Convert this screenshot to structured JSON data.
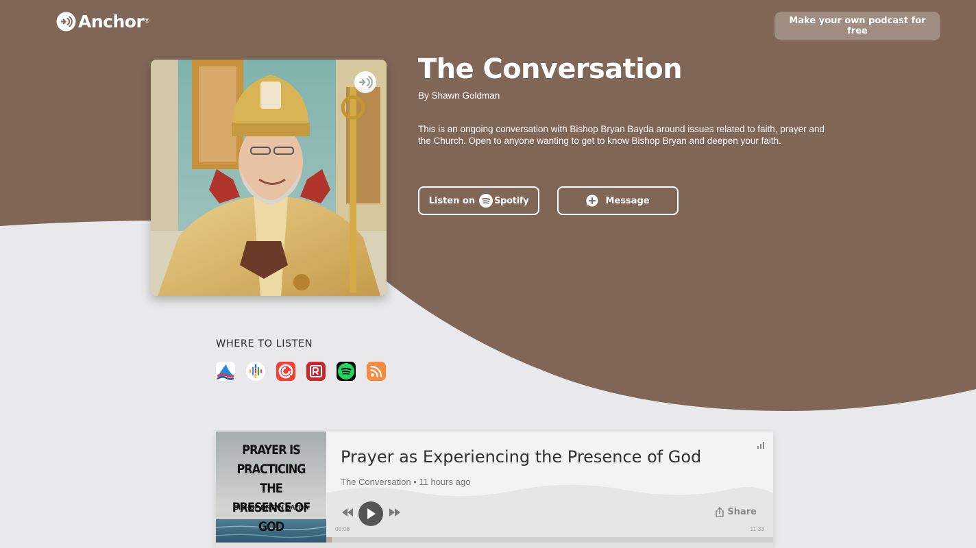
{
  "header": {
    "logo_text": "Anchor",
    "logo_reg": "®",
    "cta_label": "Make your own podcast for free"
  },
  "podcast": {
    "title": "The Conversation",
    "author": "By Shawn Goldman",
    "description": "This is an ongoing conversation with Bishop Bryan Bayda around issues related to faith, prayer and the Church. Open to anyone wanting to get to know Bishop Bryan and deepen your faith.",
    "listen_on_label": "Listen on",
    "spotify_word": "Spotify",
    "message_label": "Message"
  },
  "where_to_listen": {
    "label": "WHERE TO LISTEN",
    "platforms": [
      "breaker-icon",
      "google-podcasts-icon",
      "pocket-casts-icon",
      "radio-public-icon",
      "spotify-icon",
      "rss-icon"
    ]
  },
  "episode": {
    "art_lines": [
      "PRAYER IS",
      "PRACTICING THE",
      "PRESENCE OF GOD"
    ],
    "art_author": "BISHOP BRYAN BAYDA",
    "title": "Prayer as Experiencing the Presence of God",
    "meta": "The Conversation • 11 hours ago",
    "share_label": "Share",
    "time_current": "00:08",
    "time_total": "11:33",
    "progress": 0.012
  },
  "colors": {
    "brand_brown": "#806657",
    "page_bg": "#e9e8ea",
    "cta_bg": "#a08d82"
  }
}
